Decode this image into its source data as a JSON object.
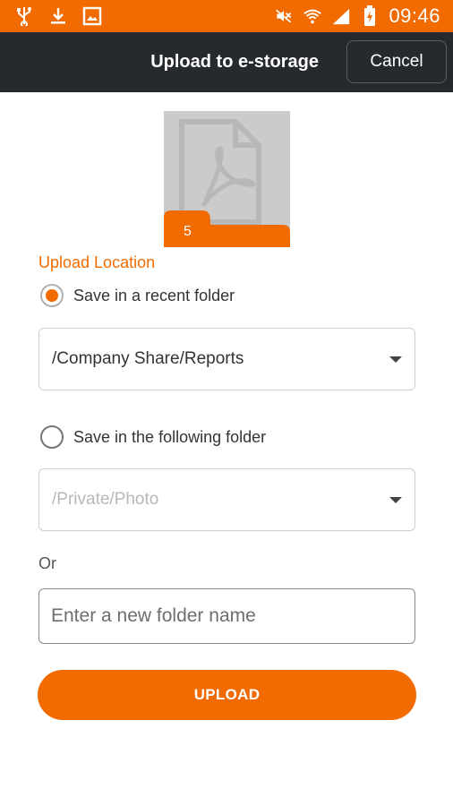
{
  "status_bar": {
    "time": "09:46",
    "left_icons": [
      "usb-icon",
      "download-icon",
      "image-icon"
    ],
    "right_icons": [
      "mute-icon",
      "wifi-icon",
      "signal-icon",
      "battery-icon"
    ]
  },
  "toolbar": {
    "title": "Upload to e-storage",
    "cancel_label": "Cancel"
  },
  "file_preview": {
    "icon": "pdf-file-icon",
    "count": "5"
  },
  "form": {
    "section_label": "Upload Location",
    "recent_option": {
      "label": "Save in a recent folder",
      "checked": true
    },
    "recent_folder": "/Company Share/Reports",
    "following_option": {
      "label": "Save in the following folder",
      "checked": false
    },
    "following_folder": "/Private/Photo",
    "or_label": "Or",
    "new_folder_placeholder": "Enter a new folder name",
    "upload_label": "UPLOAD"
  },
  "colors": {
    "accent": "#f26b00",
    "toolbar": "#262a2e"
  }
}
